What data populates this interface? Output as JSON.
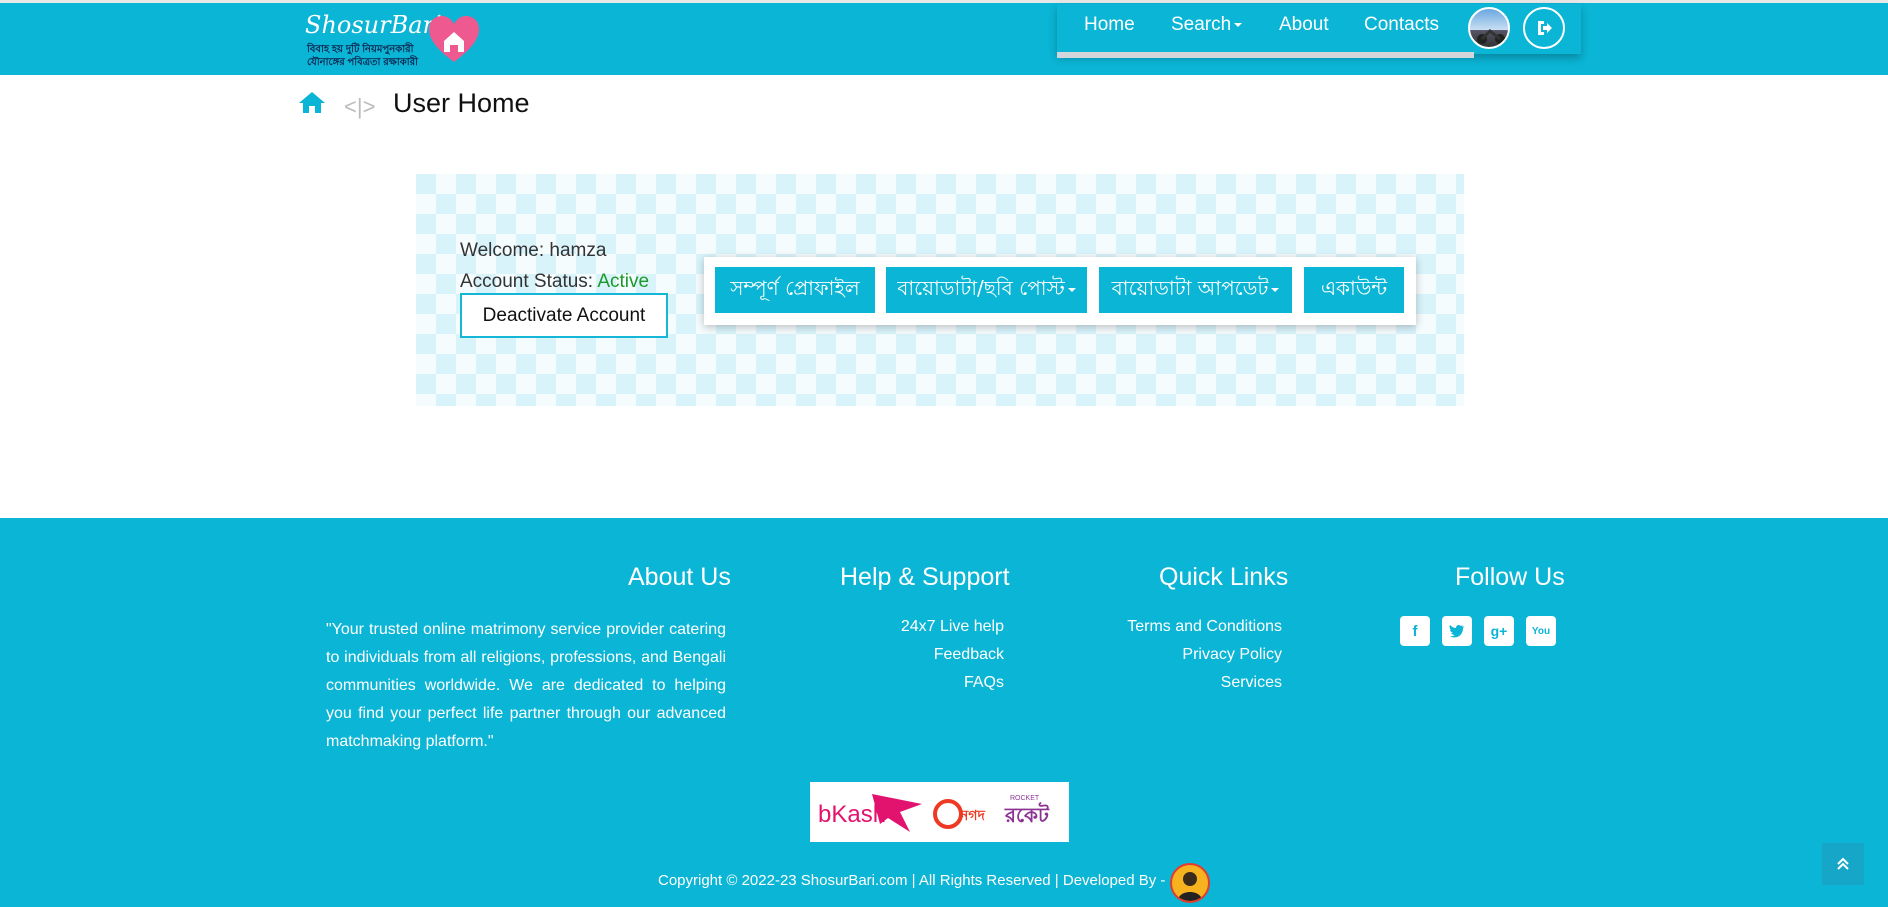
{
  "header": {
    "logo": {
      "title": "ShosurBari",
      "tagline_line1": "বিবাহ হয় দুটি নিয়মপুনকারী",
      "tagline_line2": "যৌনাঙ্গের পবিত্রতা রক্ষাকারী"
    },
    "nav": {
      "home": "Home",
      "search": "Search",
      "about": "About",
      "contacts": "Contacts"
    },
    "icons": {
      "avatar": "user-avatar",
      "logout": "sign-out-icon"
    }
  },
  "breadcrumb": {
    "home_icon": "home-icon",
    "separator": "<|>",
    "title": "User Home"
  },
  "dashboard": {
    "welcome_label": "Welcome",
    "username": "hamza",
    "status_label": "Account Status",
    "status_value": "Active",
    "deactivate_label": "Deactivate Account",
    "buttons": [
      {
        "label": "সম্পূর্ণ প্রোফাইল",
        "dropdown": false
      },
      {
        "label": "বায়োডাটা/ছবি পোস্ট",
        "dropdown": true
      },
      {
        "label": "বায়োডাটা আপডেট",
        "dropdown": true
      },
      {
        "label": "একাউন্ট",
        "dropdown": false
      }
    ]
  },
  "footer": {
    "about": {
      "heading": "About Us",
      "text": "\"Your trusted online matrimony service provider catering to individuals from all religions, professions, and Bengali communities worldwide. We are dedicated to helping you find your perfect life partner through our advanced matchmaking platform.\""
    },
    "help": {
      "heading": "Help & Support",
      "links": [
        "24x7 Live help",
        "Feedback",
        "FAQs"
      ]
    },
    "quick_links": {
      "heading": "Quick Links",
      "links": [
        "Terms and Conditions",
        "Privacy Policy",
        "Services"
      ]
    },
    "follow": {
      "heading": "Follow Us",
      "icons": [
        "facebook-icon",
        "twitter-icon",
        "google-plus-icon",
        "youtube-icon"
      ]
    },
    "payment": {
      "bkash": "bKash",
      "nagad": "নগদ",
      "rocket_small": "ROCKET",
      "rocket": "রকেট"
    },
    "copyright": "Copyright © 2022-23 ShosurBari.com | All Rights Reserved | Developed By -"
  },
  "colors": {
    "primary": "#0bb5d5",
    "status_active": "#1a9a2a",
    "bkash": "#e2136e",
    "nagad": "#ee3a24",
    "rocket": "#8c3494"
  }
}
